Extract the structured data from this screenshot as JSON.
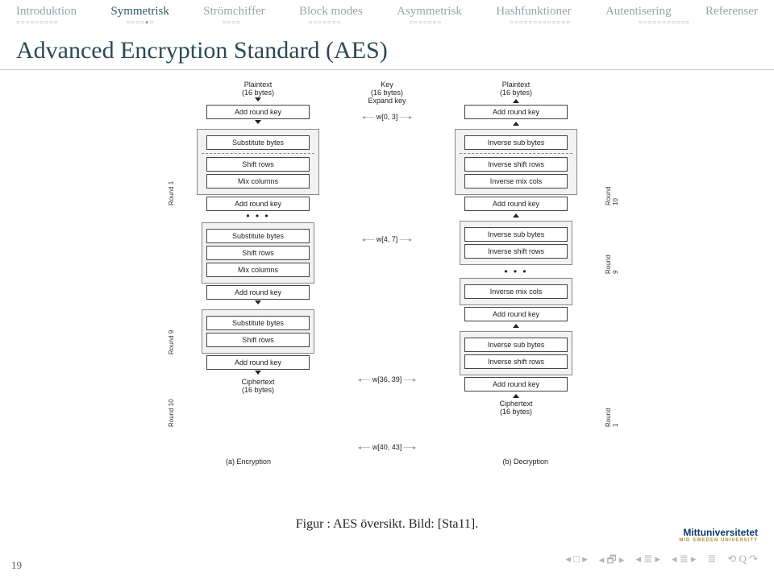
{
  "tabs": {
    "items": [
      "Introduktion",
      "Symmetrisk",
      "Strömchiffer",
      "Block modes",
      "Asymmetrisk",
      "Hashfunktioner",
      "Autentisering",
      "Referenser"
    ],
    "dots": [
      "○○○○○○○○○",
      "○○○○●○",
      "○○○○",
      "○○○○○○○",
      "○○○○○○○",
      "○○○○○○○○○○○○○",
      "○○○○○○○○○○○",
      ""
    ],
    "activeIndex": 1
  },
  "title": "Advanced Encryption Standard (AES)",
  "page": "19",
  "caption": "Figur : AES översikt. Bild: [Sta11].",
  "subcap": {
    "left": "(a) Encryption",
    "right": "(b) Decryption"
  },
  "logo": {
    "name": "Mittuniversitetet",
    "sub": "MID SWEDEN UNIVERSITY"
  },
  "nav": [
    "◂ □ ▸",
    "◂ 🗗 ▸",
    "◂ ≣ ▸",
    "◂ ≣ ▸",
    "≣",
    "⟲ Q ↷"
  ],
  "diagram": {
    "round_labels_left": [
      "Round 1",
      "Round 9",
      "Round 10"
    ],
    "round_labels_right": [
      "Round 10",
      "Round 9",
      "Round 1"
    ],
    "left": {
      "hdr": [
        "Plaintext",
        "(16 bytes)"
      ],
      "pre": "Add round key",
      "g1": [
        "Substitute bytes",
        "Shift rows",
        "Mix columns"
      ],
      "ark1": "Add round key",
      "g2": [
        "Substitute bytes",
        "Shift rows",
        "Mix columns"
      ],
      "ark2": "Add round key",
      "g3": [
        "Substitute bytes",
        "Shift rows"
      ],
      "ark3": "Add round key",
      "ftr": [
        "Ciphertext",
        "(16 bytes)"
      ]
    },
    "mid": {
      "hdr": [
        "Key",
        "(16 bytes)",
        "Expand key"
      ],
      "w": [
        "w[0, 3]",
        "w[4, 7]",
        "w[36, 39]",
        "w[40, 43]"
      ]
    },
    "right": {
      "hdr": [
        "Plaintext",
        "(16 bytes)"
      ],
      "pre": "Add round key",
      "g1": [
        "Inverse sub bytes",
        "Inverse shift rows",
        "Inverse mix cols"
      ],
      "ark1": "Add round key",
      "g2_head": [
        "Inverse sub bytes",
        "Inverse shift rows"
      ],
      "g2_tail": "Inverse mix cols",
      "ark2": "Add round key",
      "g3": [
        "Inverse sub bytes",
        "Inverse shift rows"
      ],
      "ark3": "Add round key",
      "ftr": [
        "Ciphertext",
        "(16 bytes)"
      ]
    }
  }
}
